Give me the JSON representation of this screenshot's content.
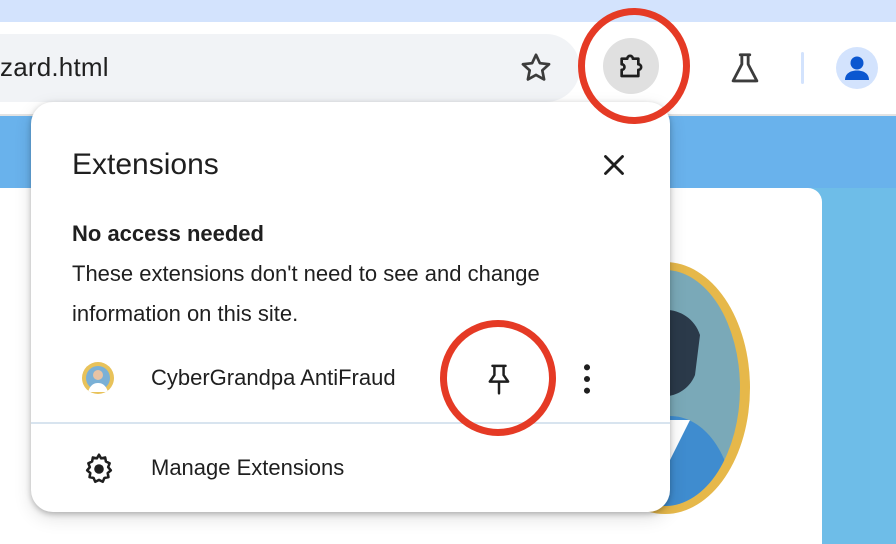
{
  "browser": {
    "url_fragment": "zard.html",
    "icons": {
      "bookmark": "star-icon",
      "extensions": "puzzle-icon",
      "labs": "flask-icon",
      "profile": "person-icon"
    }
  },
  "popup": {
    "title": "Extensions",
    "close_icon": "close-icon",
    "section_heading": "No access needed",
    "section_description": "These extensions don't need to see and change information on this site.",
    "extensions": [
      {
        "name": "CyberGrandpa AntiFraud",
        "pin_icon": "pin-icon",
        "menu_icon": "kebab-icon"
      }
    ],
    "manage": {
      "icon": "gear-icon",
      "label": "Manage Extensions"
    }
  },
  "annotations": {
    "highlight_color": "#e53a25"
  },
  "colors": {
    "page_background": "#6ebde8",
    "toolbar_strip": "#d3e3fd",
    "omnibox": "#f1f3f6"
  }
}
